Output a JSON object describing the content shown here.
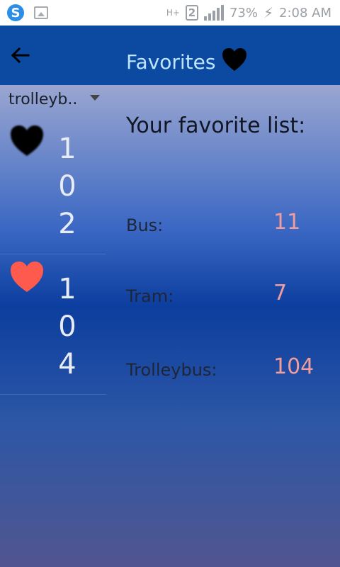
{
  "status_bar": {
    "app_icon_letter": "S",
    "network_type": "H+",
    "sim_number": "2",
    "battery": "73%",
    "time": "2:08 AM"
  },
  "app_bar": {
    "title": "Favorites",
    "back_icon": "arrow-left-icon",
    "title_icon": "heart-icon"
  },
  "spinner": {
    "selected": "trolleyb.."
  },
  "favorites": [
    {
      "number_digits": [
        "1",
        "0",
        "2"
      ],
      "heart_color": "#000000"
    },
    {
      "number_digits": [
        "1",
        "0",
        "4"
      ],
      "heart_color": "#ff5a4e"
    }
  ],
  "panel": {
    "title": "Your favorite list:",
    "rows": [
      {
        "label": "Bus:",
        "value": "11"
      },
      {
        "label": "Tram:",
        "value": "7"
      },
      {
        "label": "Trolleybus:",
        "value": "104"
      }
    ]
  },
  "colors": {
    "app_bar": "#0b4aa0",
    "title": "#bfe4ff",
    "value": "#f29c9c"
  }
}
